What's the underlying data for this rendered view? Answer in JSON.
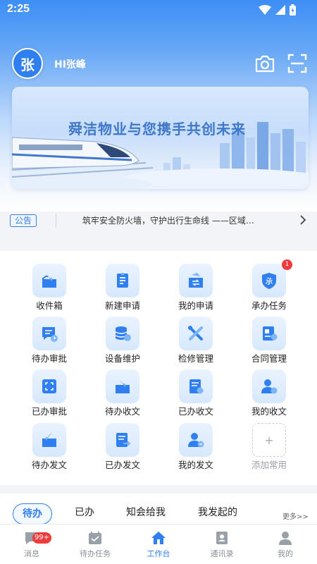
{
  "status": {
    "time": "2:25"
  },
  "header": {
    "avatar_text": "张",
    "user_name": "HI张峰"
  },
  "banner": {
    "text": "舜洁物业与您携手共创未来"
  },
  "notice": {
    "tag": "公告",
    "text": "筑牢安全防火墙，守护出行生命线 ——区域…"
  },
  "grid": {
    "items": [
      {
        "label": "收件箱",
        "icon": "inbox-icon"
      },
      {
        "label": "新建申请",
        "icon": "new-request-icon"
      },
      {
        "label": "我的申请",
        "icon": "my-request-icon"
      },
      {
        "label": "承办任务",
        "icon": "undertake-task-icon",
        "badge": "1"
      },
      {
        "label": "待办审批",
        "icon": "pending-approval-icon"
      },
      {
        "label": "设备维护",
        "icon": "device-maintenance-icon"
      },
      {
        "label": "检修管理",
        "icon": "repair-management-icon"
      },
      {
        "label": "合同管理",
        "icon": "contract-management-icon"
      },
      {
        "label": "已办审批",
        "icon": "done-approval-icon"
      },
      {
        "label": "待办收文",
        "icon": "pending-received-doc-icon"
      },
      {
        "label": "已办收文",
        "icon": "done-received-doc-icon"
      },
      {
        "label": "我的收文",
        "icon": "my-received-doc-icon"
      },
      {
        "label": "待办发文",
        "icon": "pending-sent-doc-icon"
      },
      {
        "label": "已办发文",
        "icon": "done-sent-doc-icon"
      },
      {
        "label": "我的发文",
        "icon": "my-sent-doc-icon"
      }
    ],
    "add_label": "添加常用",
    "add_symbol": "+"
  },
  "tabs": {
    "items": [
      "待办",
      "已办",
      "知会给我",
      "我发起的"
    ],
    "more": "更多>>"
  },
  "bottom_nav": {
    "items": [
      {
        "label": "消息",
        "icon": "message-icon",
        "badge": "99+"
      },
      {
        "label": "待办任务",
        "icon": "calendar-icon"
      },
      {
        "label": "工作台",
        "icon": "home-icon"
      },
      {
        "label": "通讯录",
        "icon": "contacts-icon"
      },
      {
        "label": "我的",
        "icon": "profile-icon"
      }
    ],
    "active_label": "工作台"
  },
  "colors": {
    "accent": "#2f7ff0",
    "badge": "#ef3b3b",
    "icon_bg": "#dbe9fd"
  }
}
